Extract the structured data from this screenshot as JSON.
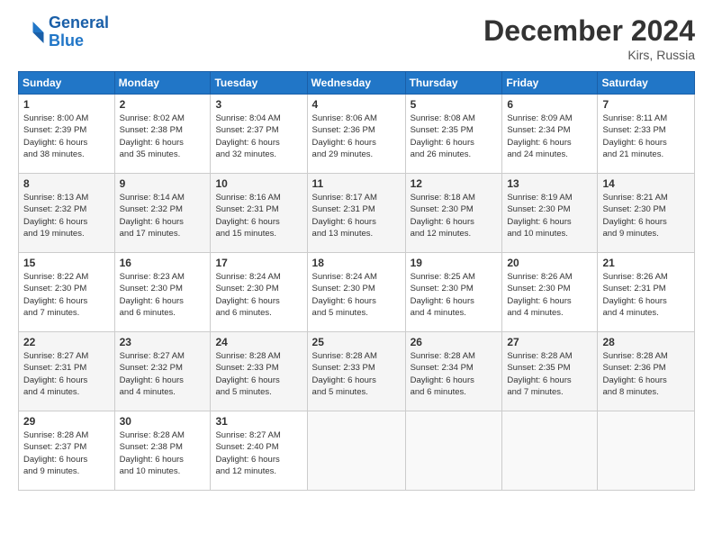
{
  "header": {
    "logo_line1": "General",
    "logo_line2": "Blue",
    "month": "December 2024",
    "location": "Kirs, Russia"
  },
  "weekdays": [
    "Sunday",
    "Monday",
    "Tuesday",
    "Wednesday",
    "Thursday",
    "Friday",
    "Saturday"
  ],
  "weeks": [
    [
      {
        "day": "1",
        "sunrise": "8:00 AM",
        "sunset": "2:39 PM",
        "daylight": "6 hours and 38 minutes."
      },
      {
        "day": "2",
        "sunrise": "8:02 AM",
        "sunset": "2:38 PM",
        "daylight": "6 hours and 35 minutes."
      },
      {
        "day": "3",
        "sunrise": "8:04 AM",
        "sunset": "2:37 PM",
        "daylight": "6 hours and 32 minutes."
      },
      {
        "day": "4",
        "sunrise": "8:06 AM",
        "sunset": "2:36 PM",
        "daylight": "6 hours and 29 minutes."
      },
      {
        "day": "5",
        "sunrise": "8:08 AM",
        "sunset": "2:35 PM",
        "daylight": "6 hours and 26 minutes."
      },
      {
        "day": "6",
        "sunrise": "8:09 AM",
        "sunset": "2:34 PM",
        "daylight": "6 hours and 24 minutes."
      },
      {
        "day": "7",
        "sunrise": "8:11 AM",
        "sunset": "2:33 PM",
        "daylight": "6 hours and 21 minutes."
      }
    ],
    [
      {
        "day": "8",
        "sunrise": "8:13 AM",
        "sunset": "2:32 PM",
        "daylight": "6 hours and 19 minutes."
      },
      {
        "day": "9",
        "sunrise": "8:14 AM",
        "sunset": "2:32 PM",
        "daylight": "6 hours and 17 minutes."
      },
      {
        "day": "10",
        "sunrise": "8:16 AM",
        "sunset": "2:31 PM",
        "daylight": "6 hours and 15 minutes."
      },
      {
        "day": "11",
        "sunrise": "8:17 AM",
        "sunset": "2:31 PM",
        "daylight": "6 hours and 13 minutes."
      },
      {
        "day": "12",
        "sunrise": "8:18 AM",
        "sunset": "2:30 PM",
        "daylight": "6 hours and 12 minutes."
      },
      {
        "day": "13",
        "sunrise": "8:19 AM",
        "sunset": "2:30 PM",
        "daylight": "6 hours and 10 minutes."
      },
      {
        "day": "14",
        "sunrise": "8:21 AM",
        "sunset": "2:30 PM",
        "daylight": "6 hours and 9 minutes."
      }
    ],
    [
      {
        "day": "15",
        "sunrise": "8:22 AM",
        "sunset": "2:30 PM",
        "daylight": "6 hours and 7 minutes."
      },
      {
        "day": "16",
        "sunrise": "8:23 AM",
        "sunset": "2:30 PM",
        "daylight": "6 hours and 6 minutes."
      },
      {
        "day": "17",
        "sunrise": "8:24 AM",
        "sunset": "2:30 PM",
        "daylight": "6 hours and 6 minutes."
      },
      {
        "day": "18",
        "sunrise": "8:24 AM",
        "sunset": "2:30 PM",
        "daylight": "6 hours and 5 minutes."
      },
      {
        "day": "19",
        "sunrise": "8:25 AM",
        "sunset": "2:30 PM",
        "daylight": "6 hours and 4 minutes."
      },
      {
        "day": "20",
        "sunrise": "8:26 AM",
        "sunset": "2:30 PM",
        "daylight": "6 hours and 4 minutes."
      },
      {
        "day": "21",
        "sunrise": "8:26 AM",
        "sunset": "2:31 PM",
        "daylight": "6 hours and 4 minutes."
      }
    ],
    [
      {
        "day": "22",
        "sunrise": "8:27 AM",
        "sunset": "2:31 PM",
        "daylight": "6 hours and 4 minutes."
      },
      {
        "day": "23",
        "sunrise": "8:27 AM",
        "sunset": "2:32 PM",
        "daylight": "6 hours and 4 minutes."
      },
      {
        "day": "24",
        "sunrise": "8:28 AM",
        "sunset": "2:33 PM",
        "daylight": "6 hours and 5 minutes."
      },
      {
        "day": "25",
        "sunrise": "8:28 AM",
        "sunset": "2:33 PM",
        "daylight": "6 hours and 5 minutes."
      },
      {
        "day": "26",
        "sunrise": "8:28 AM",
        "sunset": "2:34 PM",
        "daylight": "6 hours and 6 minutes."
      },
      {
        "day": "27",
        "sunrise": "8:28 AM",
        "sunset": "2:35 PM",
        "daylight": "6 hours and 7 minutes."
      },
      {
        "day": "28",
        "sunrise": "8:28 AM",
        "sunset": "2:36 PM",
        "daylight": "6 hours and 8 minutes."
      }
    ],
    [
      {
        "day": "29",
        "sunrise": "8:28 AM",
        "sunset": "2:37 PM",
        "daylight": "6 hours and 9 minutes."
      },
      {
        "day": "30",
        "sunrise": "8:28 AM",
        "sunset": "2:38 PM",
        "daylight": "6 hours and 10 minutes."
      },
      {
        "day": "31",
        "sunrise": "8:27 AM",
        "sunset": "2:40 PM",
        "daylight": "6 hours and 12 minutes."
      },
      null,
      null,
      null,
      null
    ]
  ]
}
